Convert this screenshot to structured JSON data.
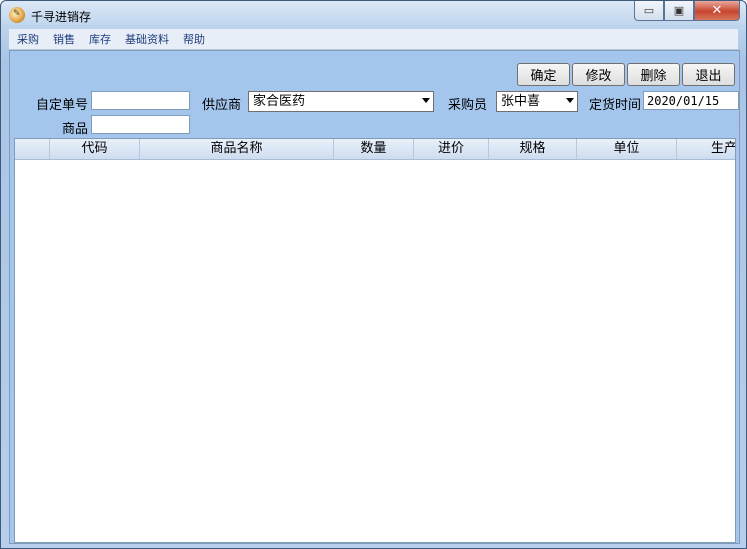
{
  "window": {
    "title": "千寻进销存",
    "icon": "app-logo-icon",
    "min_symbol": "▭",
    "max_symbol": "▣",
    "close_symbol": "✕"
  },
  "menu": [
    "采购",
    "销售",
    "库存",
    "基础资料",
    "帮助"
  ],
  "toolbar": {
    "confirm": "确定",
    "modify": "修改",
    "delete": "删除",
    "exit": "退出"
  },
  "form": {
    "order_no_label": "自定单号",
    "order_no_value": "",
    "supplier_label": "供应商",
    "supplier_value": "家合医药",
    "buyer_label": "采购员",
    "buyer_value": "张中喜",
    "order_date_label": "定货时间",
    "order_date_value": "2020/01/15",
    "product_label": "商品",
    "product_value": ""
  },
  "table": {
    "columns": [
      "",
      "代码",
      "商品名称",
      "数量",
      "进价",
      "规格",
      "单位",
      "生产"
    ],
    "rows": []
  }
}
